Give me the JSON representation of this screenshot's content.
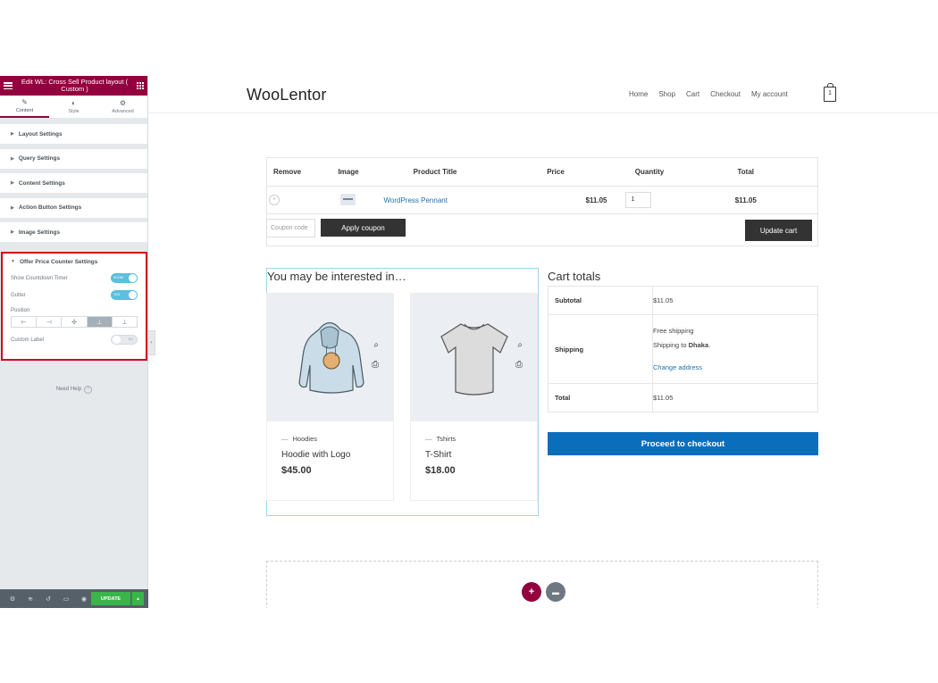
{
  "editor": {
    "title": "Edit WL: Cross Sell Product layout ( Custom )",
    "tabs": [
      {
        "label": "Content",
        "icon": "pencil-icon"
      },
      {
        "label": "Style",
        "icon": "contrast-icon"
      },
      {
        "label": "Advanced",
        "icon": "gear-icon"
      }
    ],
    "sections": [
      "Layout Settings",
      "Query Settings",
      "Content Settings",
      "Action Button Settings",
      "Image Settings"
    ],
    "open_section": {
      "title": "Offer Price Counter Settings",
      "show_countdown_label": "Show Countdown Timer",
      "show_countdown_state": "SHOW",
      "gutter_label": "Gutter",
      "gutter_state": "YES",
      "position_label": "Position",
      "custom_label": "Custom Label",
      "custom_label_state": "NO"
    },
    "need_help": "Need Help",
    "update": "UPDATE",
    "accent_color": "#93003f"
  },
  "site": {
    "logo": "WooLentor",
    "nav": [
      "Home",
      "Shop",
      "Cart",
      "Checkout",
      "My account"
    ],
    "cart_count": "1"
  },
  "cart": {
    "headers": [
      "Remove",
      "Image",
      "Product Title",
      "Price",
      "Quantity",
      "Total"
    ],
    "row": {
      "title": "WordPress Pennant",
      "price": "$11.05",
      "qty": "1",
      "total": "$11.05"
    },
    "coupon_placeholder": "Coupon code",
    "apply": "Apply coupon",
    "update": "Update cart"
  },
  "cross_sell": {
    "title": "You may be interested in…",
    "products": [
      {
        "category": "Hoodies",
        "name": "Hoodie with Logo",
        "price": "$45.00"
      },
      {
        "category": "Tshirts",
        "name": "T-Shirt",
        "price": "$18.00"
      }
    ]
  },
  "totals": {
    "title": "Cart totals",
    "subtotal_label": "Subtotal",
    "subtotal": "$11.05",
    "shipping_label": "Shipping",
    "shipping_method": "Free shipping",
    "shipping_to_prefix": "Shipping to ",
    "shipping_to_city": "Dhaka",
    "shipping_to_suffix": ".",
    "change_address": "Change address",
    "total_label": "Total",
    "total": "$11.05",
    "checkout": "Proceed to checkout"
  }
}
